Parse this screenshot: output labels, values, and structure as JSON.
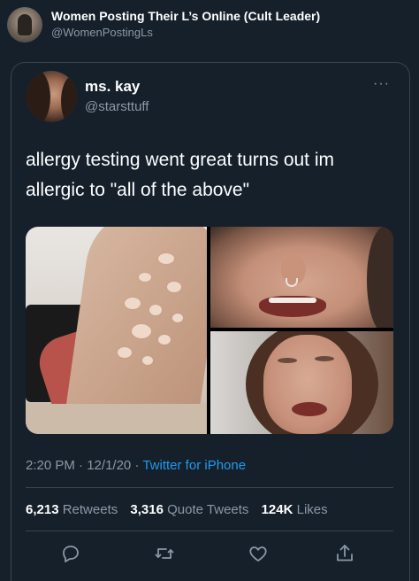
{
  "header": {
    "account_name": "Women Posting Their L’s Online (Cult Leader)",
    "account_handle": "@WomenPostingLs"
  },
  "tweet": {
    "author_name": "ms. kay",
    "author_handle": "@starsttuff",
    "more_label": "···",
    "text": "allergy testing went great turns out im allergic to \"all of the above\"",
    "time": "2:20 PM",
    "date": "12/1/20",
    "separator": "·",
    "source": "Twitter for iPhone"
  },
  "stats": {
    "retweets_count": "6,213",
    "retweets_label": "Retweets",
    "quotes_count": "3,316",
    "quotes_label": "Quote Tweets",
    "likes_count": "124K",
    "likes_label": "Likes"
  },
  "actions": {
    "icons": [
      "reply-icon",
      "retweet-icon",
      "like-icon",
      "share-icon"
    ]
  },
  "colors": {
    "background": "#15202b",
    "text_primary": "#ffffff",
    "text_secondary": "#8b98a5",
    "link": "#1d9bf0",
    "border": "#38444d"
  }
}
